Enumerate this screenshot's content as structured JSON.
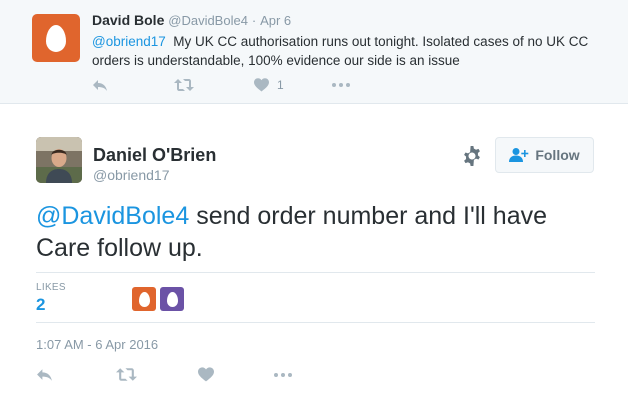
{
  "colors": {
    "parent_avatar": "#e0652d",
    "liker_1": "#e0652d",
    "liker_2": "#6b52a6",
    "link": "#1b95e0"
  },
  "parent_tweet": {
    "fullname": "David Bole",
    "handle": "@DavidBole4",
    "separator": "·",
    "time": "Apr 6",
    "mention": "@obriend17",
    "text": "My UK CC authorisation runs out tonight. Isolated cases of no UK CC orders is understandable, 100% evidence our side is an issue",
    "like_count": "1",
    "actions": [
      "reply-icon",
      "retweet-icon",
      "heart-icon",
      "more-icon"
    ]
  },
  "main_tweet": {
    "fullname": "Daniel O'Brien",
    "handle": "@obriend17",
    "follow_label": "Follow",
    "mention": "@DavidBole4",
    "text": " send order number and I'll have Care follow up.",
    "likes_label": "LIKES",
    "likes_count": "2",
    "timestamp": "1:07 AM - 6 Apr 2016",
    "actions": [
      "reply-icon",
      "retweet-icon",
      "heart-icon",
      "more-icon"
    ]
  }
}
